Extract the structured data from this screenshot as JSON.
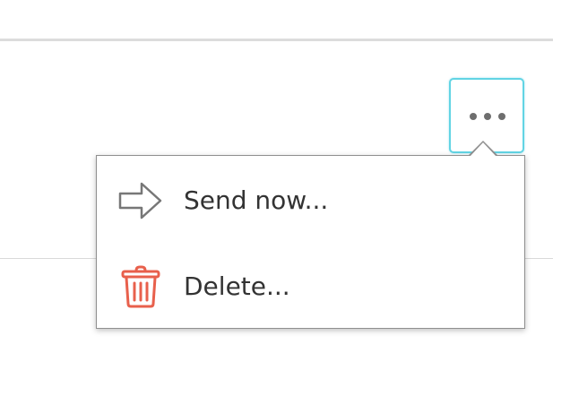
{
  "more_button": {
    "icon": "more-horizontal-icon",
    "accent_color": "#62d4e4"
  },
  "menu": {
    "items": [
      {
        "label": "Send now...",
        "icon": "arrow-right-icon",
        "icon_color": "#777777"
      },
      {
        "label": "Delete...",
        "icon": "trash-icon",
        "icon_color": "#e8604c"
      }
    ]
  }
}
